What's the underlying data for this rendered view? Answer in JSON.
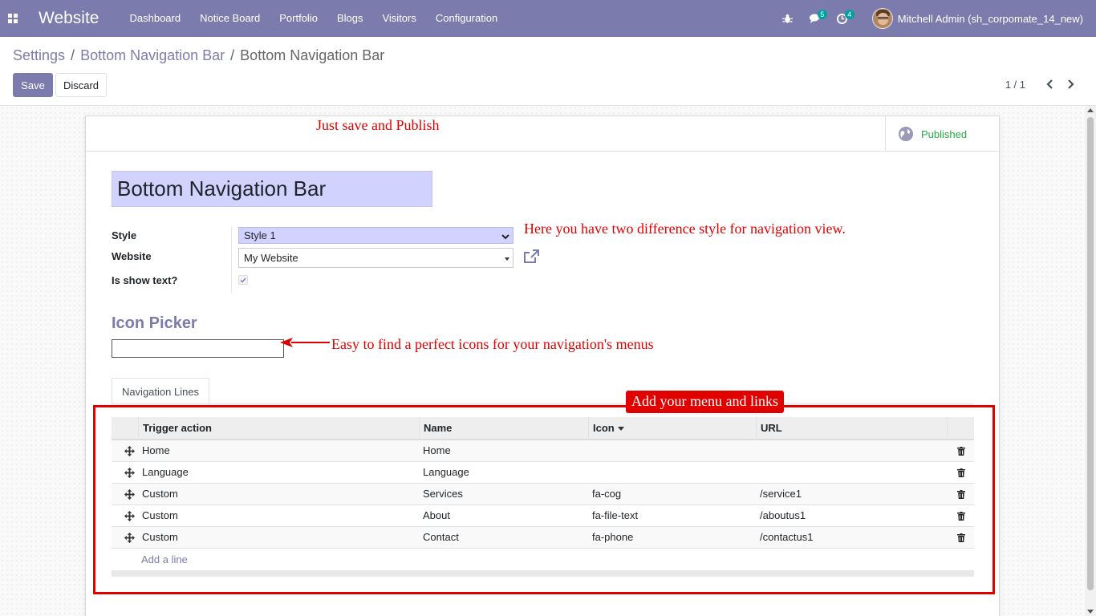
{
  "navbar": {
    "app_name": "Website",
    "menu": [
      "Dashboard",
      "Notice Board",
      "Portfolio",
      "Blogs",
      "Visitors",
      "Configuration"
    ],
    "messages_count": "5",
    "activities_count": "4",
    "user_name": "Mitchell Admin (sh_corpomate_14_new)",
    "color": "#7c7bad"
  },
  "breadcrumb": {
    "items": [
      "Settings",
      "Bottom Navigation Bar",
      "Bottom Navigation Bar"
    ]
  },
  "buttons": {
    "save": "Save",
    "discard": "Discard"
  },
  "pager": {
    "value": "1 / 1"
  },
  "record": {
    "published_label": "Published",
    "title": "Bottom Navigation Bar",
    "fields": {
      "style_label": "Style",
      "style_value": "Style 1",
      "website_label": "Website",
      "website_value": "My Website",
      "show_text_label": "Is show text?",
      "show_text_checked": true
    },
    "icon_picker_title": "Icon Picker",
    "icon_picker_value": "",
    "tab_label": "Navigation Lines",
    "table": {
      "columns": [
        "Trigger action",
        "Name",
        "Icon",
        "URL"
      ],
      "rows": [
        {
          "trigger": "Home",
          "name": "Home",
          "icon": "",
          "url": ""
        },
        {
          "trigger": "Language",
          "name": "Language",
          "icon": "",
          "url": ""
        },
        {
          "trigger": "Custom",
          "name": "Services",
          "icon": "fa-cog",
          "url": "/service1"
        },
        {
          "trigger": "Custom",
          "name": "About",
          "icon": "fa-file-text",
          "url": "/aboutus1"
        },
        {
          "trigger": "Custom",
          "name": "Contact",
          "icon": "fa-phone",
          "url": "/contactus1"
        }
      ],
      "add_line": "Add a line"
    }
  },
  "annotations": {
    "publish": "Just save and Publish",
    "style": "Here you have two difference style for navigation view.",
    "icon_picker": "Easy to find a perfect icons for your navigation's menus",
    "lines": "Add your menu and links",
    "color": "#e00000"
  }
}
